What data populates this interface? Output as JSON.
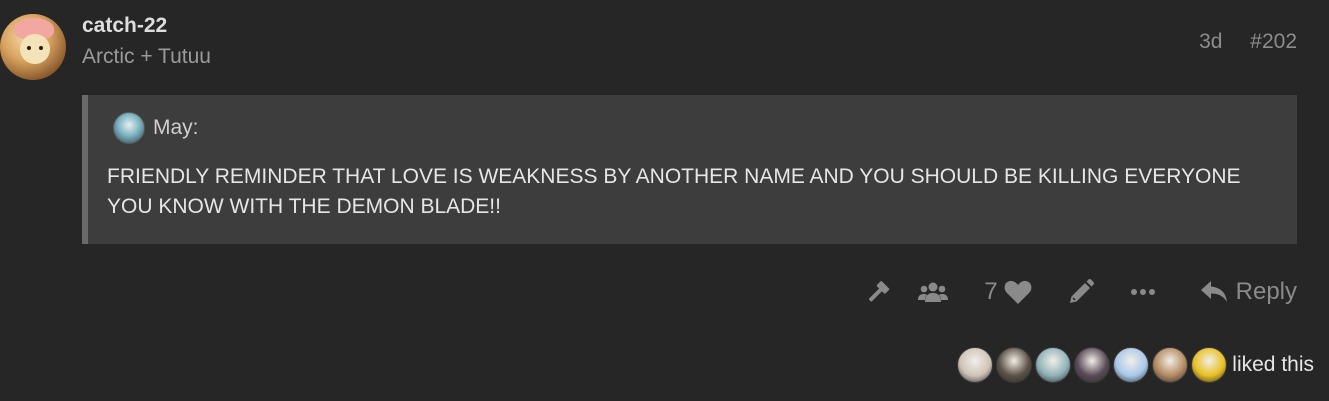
{
  "post": {
    "username": "catch-22",
    "user_title": "Arctic + Tutuu",
    "age": "3d",
    "post_number": "#202"
  },
  "quote": {
    "author": "May:",
    "text": "FRIENDLY REMINDER THAT LOVE IS WEAKNESS BY ANOTHER NAME AND YOU SHOULD BE KILLING EVERYONE YOU KNOW WITH THE DEMON BLADE!!"
  },
  "actions": {
    "icons": [
      "gavel-icon",
      "users-icon",
      "heart-icon",
      "pencil-icon",
      "ellipsis-icon",
      "reply-icon"
    ],
    "like_count": "7",
    "reply_label": "Reply"
  },
  "likes": {
    "text": "liked this",
    "avatar_colors": [
      "#cfc3b8",
      "#5c5246",
      "#8fb2b8",
      "#5a4a58",
      "#a8c8e8",
      "#b38a60",
      "#e8c020"
    ]
  }
}
